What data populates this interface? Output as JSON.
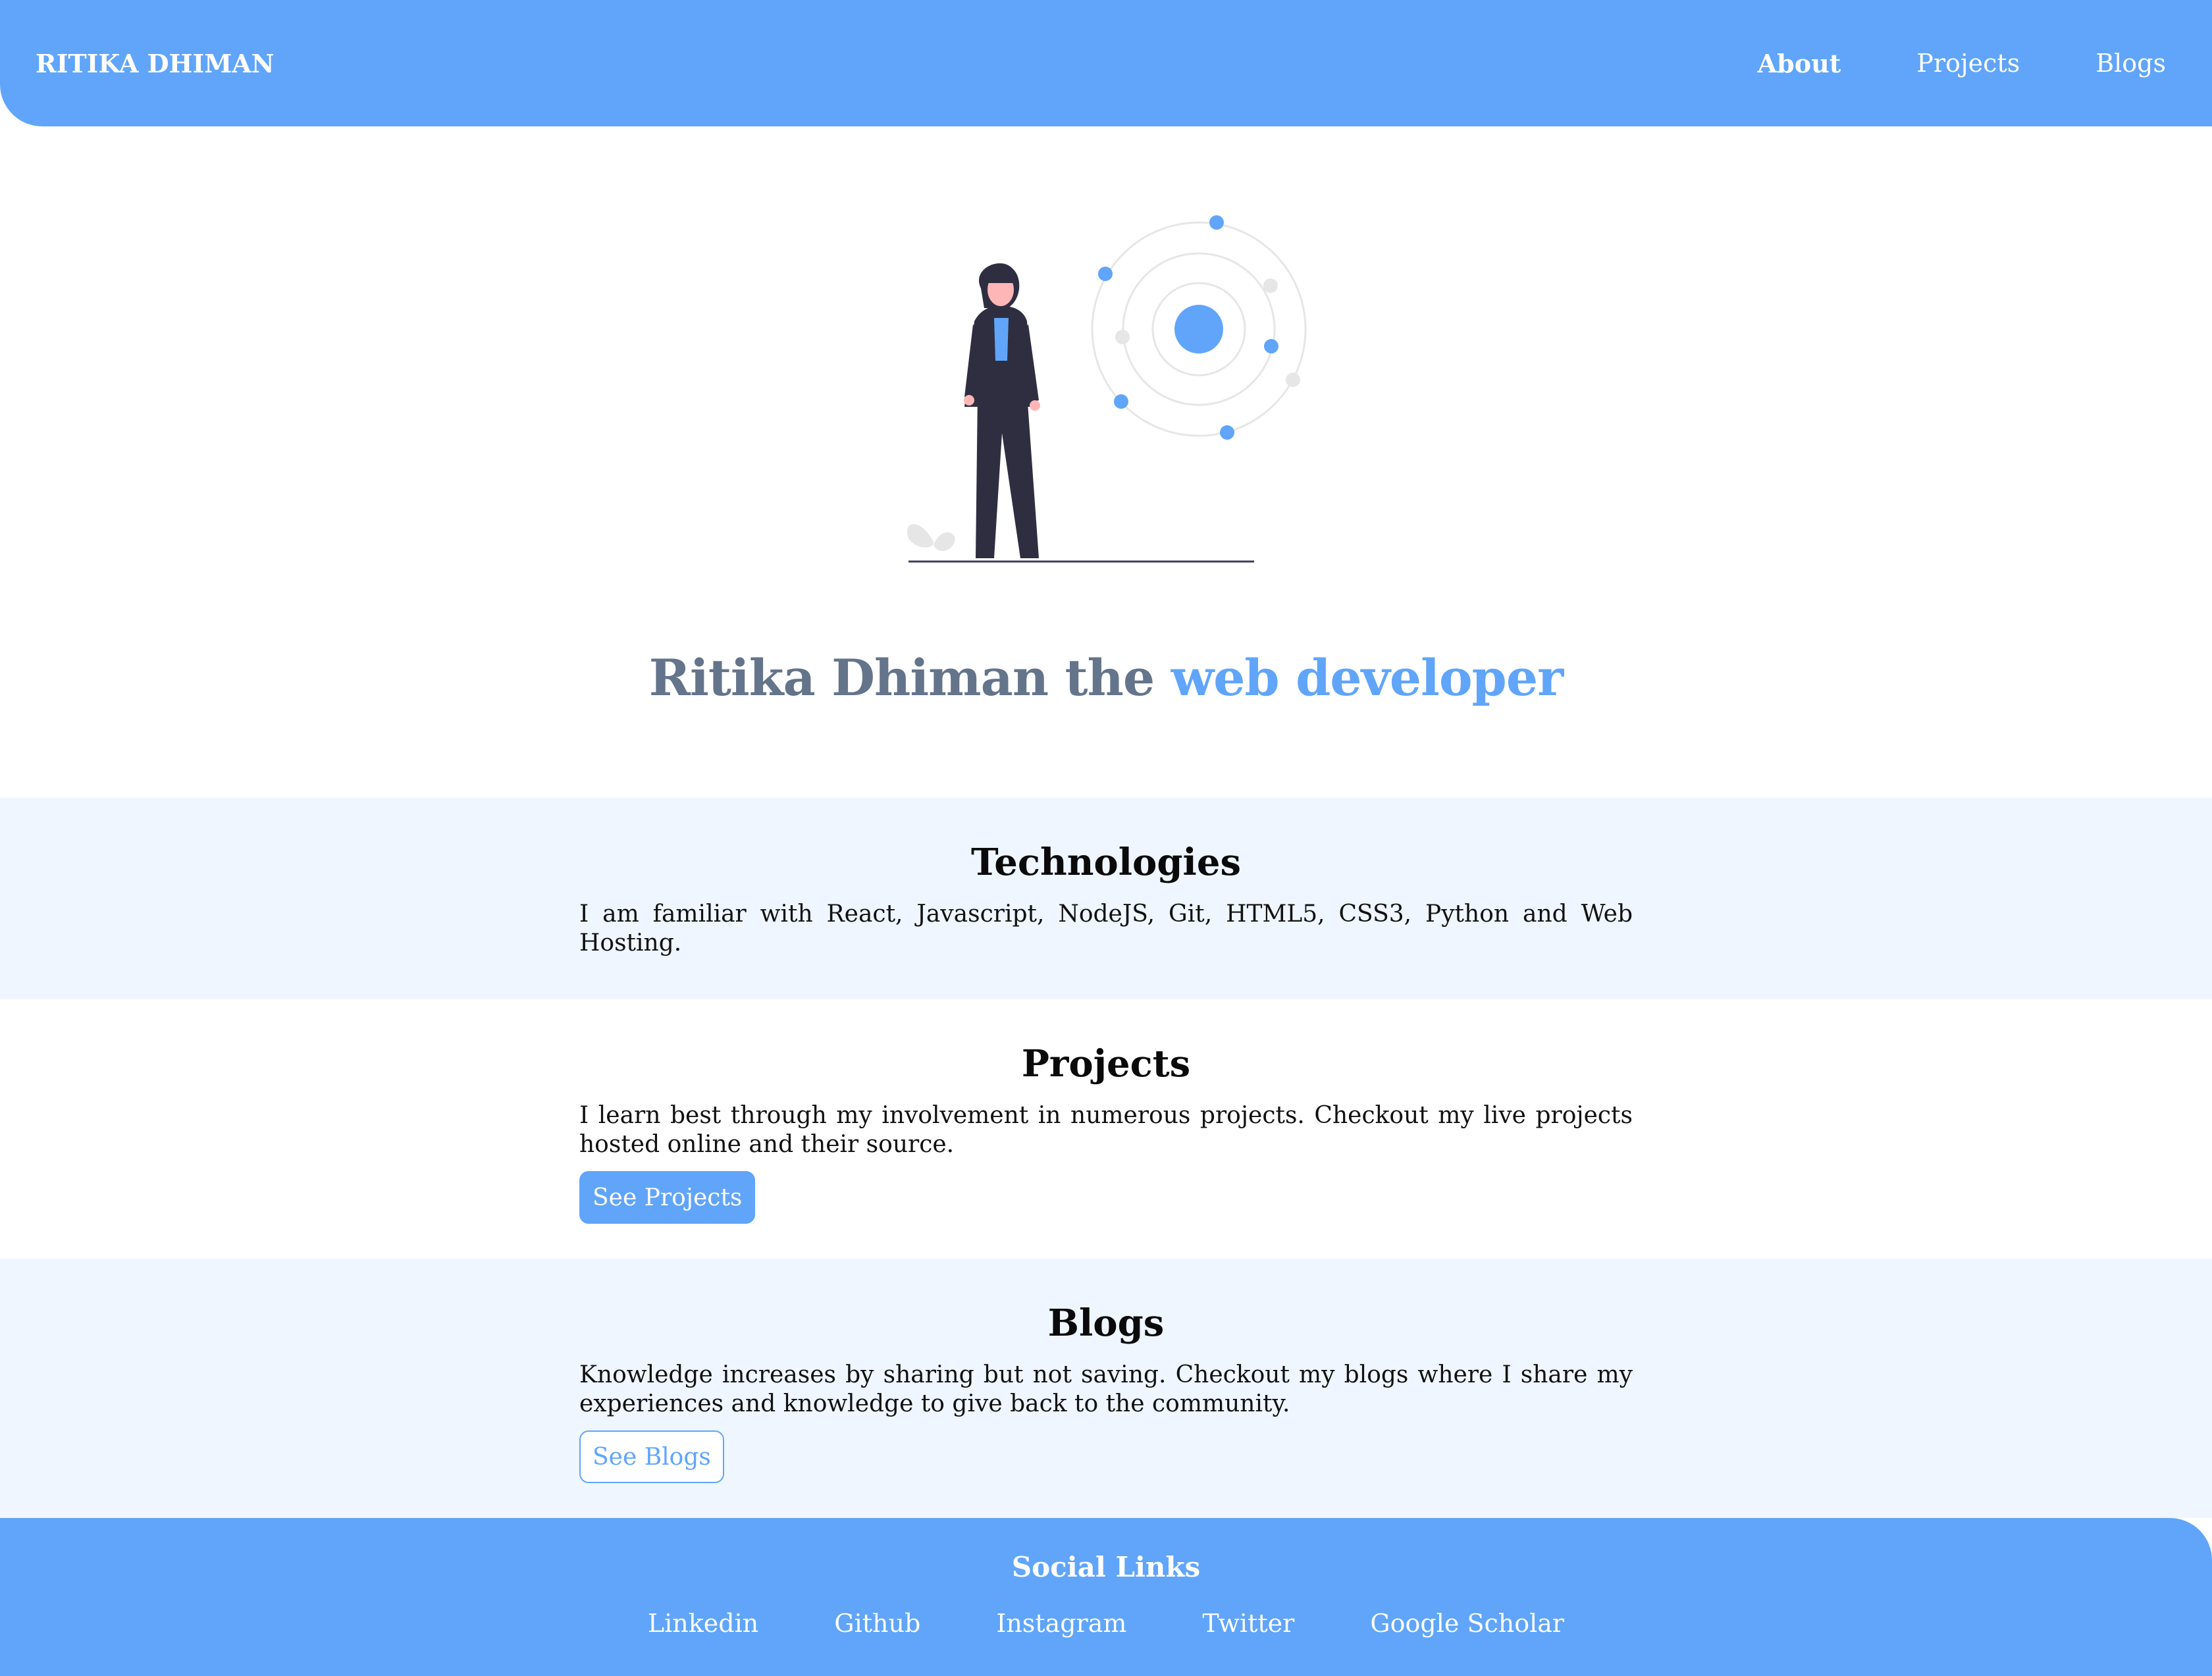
{
  "nav": {
    "brand": "RITIKA DHIMAN",
    "links": [
      {
        "label": "About",
        "active": true
      },
      {
        "label": "Projects",
        "active": false
      },
      {
        "label": "Blogs",
        "active": false
      }
    ]
  },
  "hero": {
    "title_main": "Ritika Dhiman the ",
    "title_accent": "web developer",
    "illustration_icon": "woman-with-orbit-illustration"
  },
  "sections": {
    "technologies": {
      "heading": "Technologies",
      "text": "I am familiar with React, Javascript, NodeJS, Git, HTML5, CSS3, Python and Web Hosting."
    },
    "projects": {
      "heading": "Projects",
      "text": "I learn best through my involvement in numerous projects. Checkout my live projects hosted online and their source.",
      "button": "See Projects"
    },
    "blogs": {
      "heading": "Blogs",
      "text": "Knowledge increases by sharing but not saving. Checkout my blogs where I share my experiences and knowledge to give back to the community.",
      "button": "See Blogs"
    }
  },
  "footer": {
    "heading": "Social Links",
    "links": [
      "Linkedin",
      "Github",
      "Instagram",
      "Twitter",
      "Google Scholar"
    ]
  },
  "colors": {
    "accent": "#60a5fa",
    "section_bg": "#eff6ff",
    "title_gray": "#64748b"
  }
}
